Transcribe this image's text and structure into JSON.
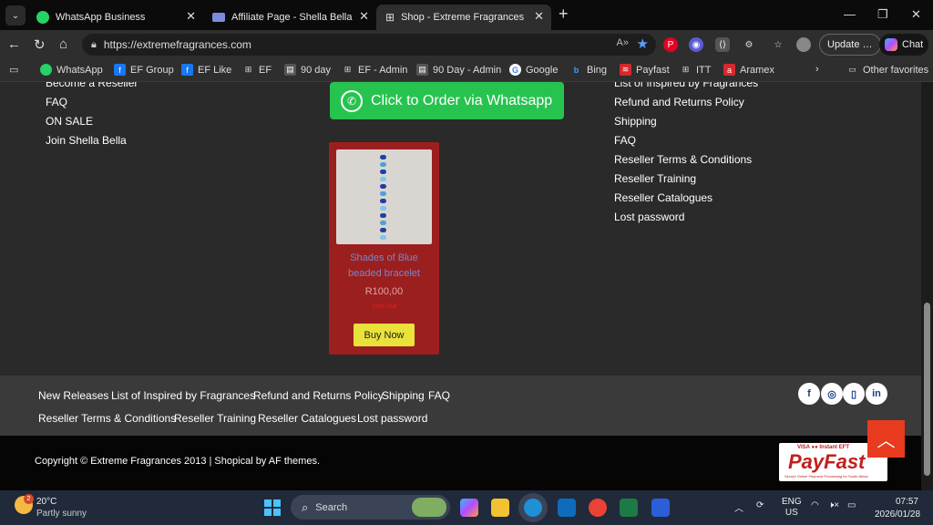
{
  "browser": {
    "tabs": [
      {
        "title": "WhatsApp Business",
        "icon": "whatsapp-icon"
      },
      {
        "title": "Affiliate Page - Shella Bella",
        "icon": "affiliate-icon"
      },
      {
        "title": "Shop - Extreme Fragrances",
        "icon": "shop-icon",
        "active": true
      }
    ],
    "address": {
      "url": "https://extremefragrances.com"
    },
    "update_label": "Update",
    "chat_label": "Chat",
    "favorites": [
      {
        "label": "WhatsApp",
        "icon": "whatsapp-icon"
      },
      {
        "label": "EF Group",
        "icon": "facebook-icon"
      },
      {
        "label": "EF Like",
        "icon": "facebook-icon"
      },
      {
        "label": "EF",
        "icon": "grid-icon"
      },
      {
        "label": "90 day",
        "icon": "doc-icon"
      },
      {
        "label": "EF - Admin",
        "icon": "grid-icon"
      },
      {
        "label": "90 Day - Admin",
        "icon": "doc-icon"
      },
      {
        "label": "Google",
        "icon": "google-icon"
      },
      {
        "label": "Bing",
        "icon": "bing-icon"
      },
      {
        "label": "Payfast",
        "icon": "payfast-icon"
      },
      {
        "label": "ITT",
        "icon": "grid-icon"
      },
      {
        "label": "Aramex",
        "icon": "aramex-icon"
      }
    ],
    "other_favorites": "Other favorites"
  },
  "page": {
    "left_links": [
      "Become a Reseller",
      "FAQ",
      "ON SALE",
      "Join Shella Bella"
    ],
    "whatsapp_button": "Click to Order via Whatsapp",
    "product": {
      "name_line1": "Shades of Blue",
      "name_line2": "beaded bracelet",
      "price": "R100,00",
      "status": "Sold Out",
      "buy_label": "Buy Now"
    },
    "right_links": [
      "List of Inspired by Fragrances",
      "Refund and Returns Policy",
      "Shipping",
      "FAQ",
      "Reseller Terms & Conditions",
      "Reseller Training",
      "Reseller Catalogues",
      "Lost password"
    ],
    "footer_row1": [
      "New Releases",
      "List of Inspired by Fragrances",
      "Refund and Returns Policy",
      "Shipping",
      "FAQ"
    ],
    "footer_row2": [
      "Reseller Terms & Conditions",
      "Reseller Training",
      "Reseller Catalogues",
      "Lost password"
    ],
    "social": [
      {
        "glyph": "f",
        "icon": "facebook-icon"
      },
      {
        "glyph": "◎",
        "icon": "instagram-icon"
      },
      {
        "glyph": "▯",
        "icon": "phone-icon"
      },
      {
        "glyph": "in",
        "icon": "linkedin-icon"
      }
    ],
    "copyright": "Copyright © Extreme Fragrances 2013 | Shopical by AF themes.",
    "payfast": {
      "top": "VISA  ●●  Instant EFT",
      "brand": "PayFast",
      "tagline": "Secure Online Payment Processing for South Africa"
    }
  },
  "taskbar": {
    "temp": "20°C",
    "weather": "Partly sunny",
    "badge": "2",
    "search_label": "Search",
    "lang1": "ENG",
    "lang2": "US",
    "time": "07:57",
    "date": "2026/01/28"
  },
  "colors": {
    "whatsapp_green": "#27c34f",
    "card_red": "#9b1f1f",
    "buy_yellow": "#e8e23a",
    "scroll_top_orange": "#e83b1f"
  }
}
